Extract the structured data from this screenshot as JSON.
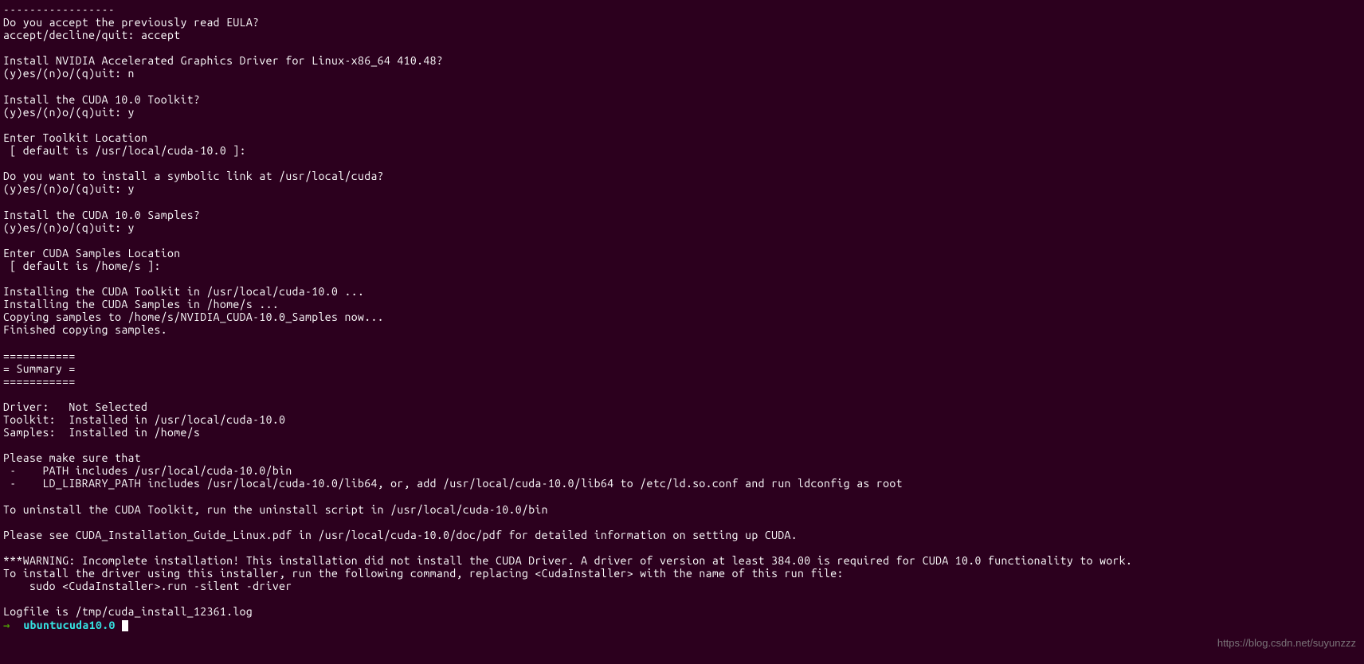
{
  "terminal": {
    "lines": [
      "-----------------",
      "Do you accept the previously read EULA?",
      "accept/decline/quit: accept",
      "",
      "Install NVIDIA Accelerated Graphics Driver for Linux-x86_64 410.48?",
      "(y)es/(n)o/(q)uit: n",
      "",
      "Install the CUDA 10.0 Toolkit?",
      "(y)es/(n)o/(q)uit: y",
      "",
      "Enter Toolkit Location",
      " [ default is /usr/local/cuda-10.0 ]:",
      "",
      "Do you want to install a symbolic link at /usr/local/cuda?",
      "(y)es/(n)o/(q)uit: y",
      "",
      "Install the CUDA 10.0 Samples?",
      "(y)es/(n)o/(q)uit: y",
      "",
      "Enter CUDA Samples Location",
      " [ default is /home/s ]:",
      "",
      "Installing the CUDA Toolkit in /usr/local/cuda-10.0 ...",
      "Installing the CUDA Samples in /home/s ...",
      "Copying samples to /home/s/NVIDIA_CUDA-10.0_Samples now...",
      "Finished copying samples.",
      "",
      "===========",
      "= Summary =",
      "===========",
      "",
      "Driver:   Not Selected",
      "Toolkit:  Installed in /usr/local/cuda-10.0",
      "Samples:  Installed in /home/s",
      "",
      "Please make sure that",
      " -    PATH includes /usr/local/cuda-10.0/bin",
      " -    LD_LIBRARY_PATH includes /usr/local/cuda-10.0/lib64, or, add /usr/local/cuda-10.0/lib64 to /etc/ld.so.conf and run ldconfig as root",
      "",
      "To uninstall the CUDA Toolkit, run the uninstall script in /usr/local/cuda-10.0/bin",
      "",
      "Please see CUDA_Installation_Guide_Linux.pdf in /usr/local/cuda-10.0/doc/pdf for detailed information on setting up CUDA.",
      "",
      "***WARNING: Incomplete installation! This installation did not install the CUDA Driver. A driver of version at least 384.00 is required for CUDA 10.0 functionality to work.",
      "To install the driver using this installer, run the following command, replacing <CudaInstaller> with the name of this run file:",
      "    sudo <CudaInstaller>.run -silent -driver",
      "",
      "Logfile is /tmp/cuda_install_12361.log"
    ],
    "prompt": {
      "arrow": "→ ",
      "path": " ubuntucuda10.0"
    }
  },
  "watermark": "https://blog.csdn.net/suyunzzz"
}
